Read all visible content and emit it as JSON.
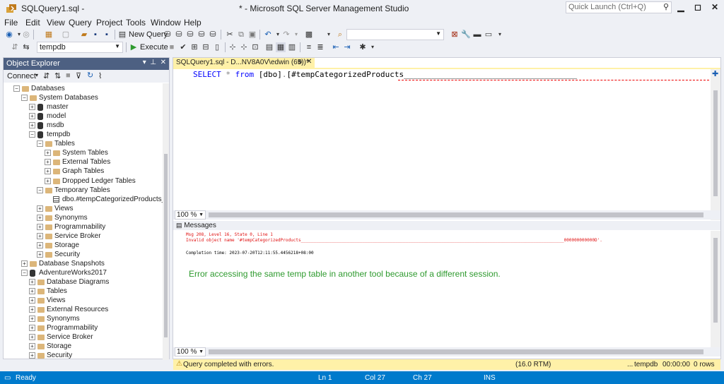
{
  "titlebar": {
    "doc_title": "SQLQuery1.sql -",
    "window_title": "* - Microsoft SQL Server Management Studio",
    "quick_launch_placeholder": "Quick Launch (Ctrl+Q)"
  },
  "menu": [
    "File",
    "Edit",
    "View",
    "Query",
    "Project",
    "Tools",
    "Window",
    "Help"
  ],
  "toolbar": {
    "new_query_label": "New Query",
    "database": "tempdb",
    "execute_label": "Execute"
  },
  "object_explorer": {
    "title": "Object Explorer",
    "connect_label": "Connect",
    "tree": [
      {
        "label": "Databases",
        "level": 0,
        "expander": "minus",
        "icon": "folder"
      },
      {
        "label": "System Databases",
        "level": 1,
        "expander": "minus",
        "icon": "folder"
      },
      {
        "label": "master",
        "level": 2,
        "expander": "plus",
        "icon": "database"
      },
      {
        "label": "model",
        "level": 2,
        "expander": "plus",
        "icon": "database"
      },
      {
        "label": "msdb",
        "level": 2,
        "expander": "plus",
        "icon": "database"
      },
      {
        "label": "tempdb",
        "level": 2,
        "expander": "minus",
        "icon": "database"
      },
      {
        "label": "Tables",
        "level": 3,
        "expander": "minus",
        "icon": "folder"
      },
      {
        "label": "System Tables",
        "level": 4,
        "expander": "plus",
        "icon": "folder"
      },
      {
        "label": "External Tables",
        "level": 4,
        "expander": "plus",
        "icon": "folder"
      },
      {
        "label": "Graph Tables",
        "level": 4,
        "expander": "plus",
        "icon": "folder"
      },
      {
        "label": "Dropped Ledger Tables",
        "level": 4,
        "expander": "plus",
        "icon": "folder"
      },
      {
        "label": "Temporary Tables",
        "level": 3,
        "expander": "minus",
        "icon": "folder"
      },
      {
        "label": "dbo.#tempCategorizedProducts___",
        "level": 4,
        "expander": "none",
        "icon": "table"
      },
      {
        "label": "Views",
        "level": 3,
        "expander": "plus",
        "icon": "folder"
      },
      {
        "label": "Synonyms",
        "level": 3,
        "expander": "plus",
        "icon": "folder"
      },
      {
        "label": "Programmability",
        "level": 3,
        "expander": "plus",
        "icon": "folder"
      },
      {
        "label": "Service Broker",
        "level": 3,
        "expander": "plus",
        "icon": "folder"
      },
      {
        "label": "Storage",
        "level": 3,
        "expander": "plus",
        "icon": "folder"
      },
      {
        "label": "Security",
        "level": 3,
        "expander": "plus",
        "icon": "folder"
      },
      {
        "label": "Database Snapshots",
        "level": 1,
        "expander": "plus",
        "icon": "folder"
      },
      {
        "label": "AdventureWorks2017",
        "level": 1,
        "expander": "minus",
        "icon": "database"
      },
      {
        "label": "Database Diagrams",
        "level": 2,
        "expander": "plus",
        "icon": "folder"
      },
      {
        "label": "Tables",
        "level": 2,
        "expander": "plus",
        "icon": "folder"
      },
      {
        "label": "Views",
        "level": 2,
        "expander": "plus",
        "icon": "folder"
      },
      {
        "label": "External Resources",
        "level": 2,
        "expander": "plus",
        "icon": "folder"
      },
      {
        "label": "Synonyms",
        "level": 2,
        "expander": "plus",
        "icon": "folder"
      },
      {
        "label": "Programmability",
        "level": 2,
        "expander": "plus",
        "icon": "folder"
      },
      {
        "label": "Service Broker",
        "level": 2,
        "expander": "plus",
        "icon": "folder"
      },
      {
        "label": "Storage",
        "level": 2,
        "expander": "plus",
        "icon": "folder"
      },
      {
        "label": "Security",
        "level": 2,
        "expander": "plus",
        "icon": "folder"
      }
    ]
  },
  "editor": {
    "tab_label": "SQLQuery1.sql - D...NV8A0V\\edwin (65))*",
    "code": {
      "kw1": "SELECT",
      "star": "*",
      "kw2": "from",
      "schema": "[dbo]",
      "dot": ".",
      "table": "[#tempCategorizedProducts_____________________________________"
    },
    "zoom": "100 %"
  },
  "messages": {
    "header": "Messages",
    "line1": "Msg 208, Level 16, State 0, Line 1",
    "line2": "Invalid object name '#tempCategorizedProducts_______________________________________________________________________________________________________000000000000D'.",
    "line3": "Completion time: 2023-07-20T12:11:55.4456218+08:00",
    "note": "Error accessing the same temp table in another tool because of a different session.",
    "zoom": "100 %"
  },
  "query_status": {
    "text": "Query completed with errors.",
    "version": "(16.0 RTM)",
    "server": "...",
    "database": "tempdb",
    "elapsed": "00:00:00",
    "rows": "0 rows"
  },
  "statusbar": {
    "ready": "Ready",
    "ln": "Ln 1",
    "col": "Col 27",
    "ch": "Ch 27",
    "mode": "INS"
  },
  "colors": {
    "accent": "#007acc",
    "oe_header": "#4d6082",
    "tab_yellow": "#fff1a8",
    "note_green": "#2e9a2e",
    "error_red": "#e01010"
  }
}
